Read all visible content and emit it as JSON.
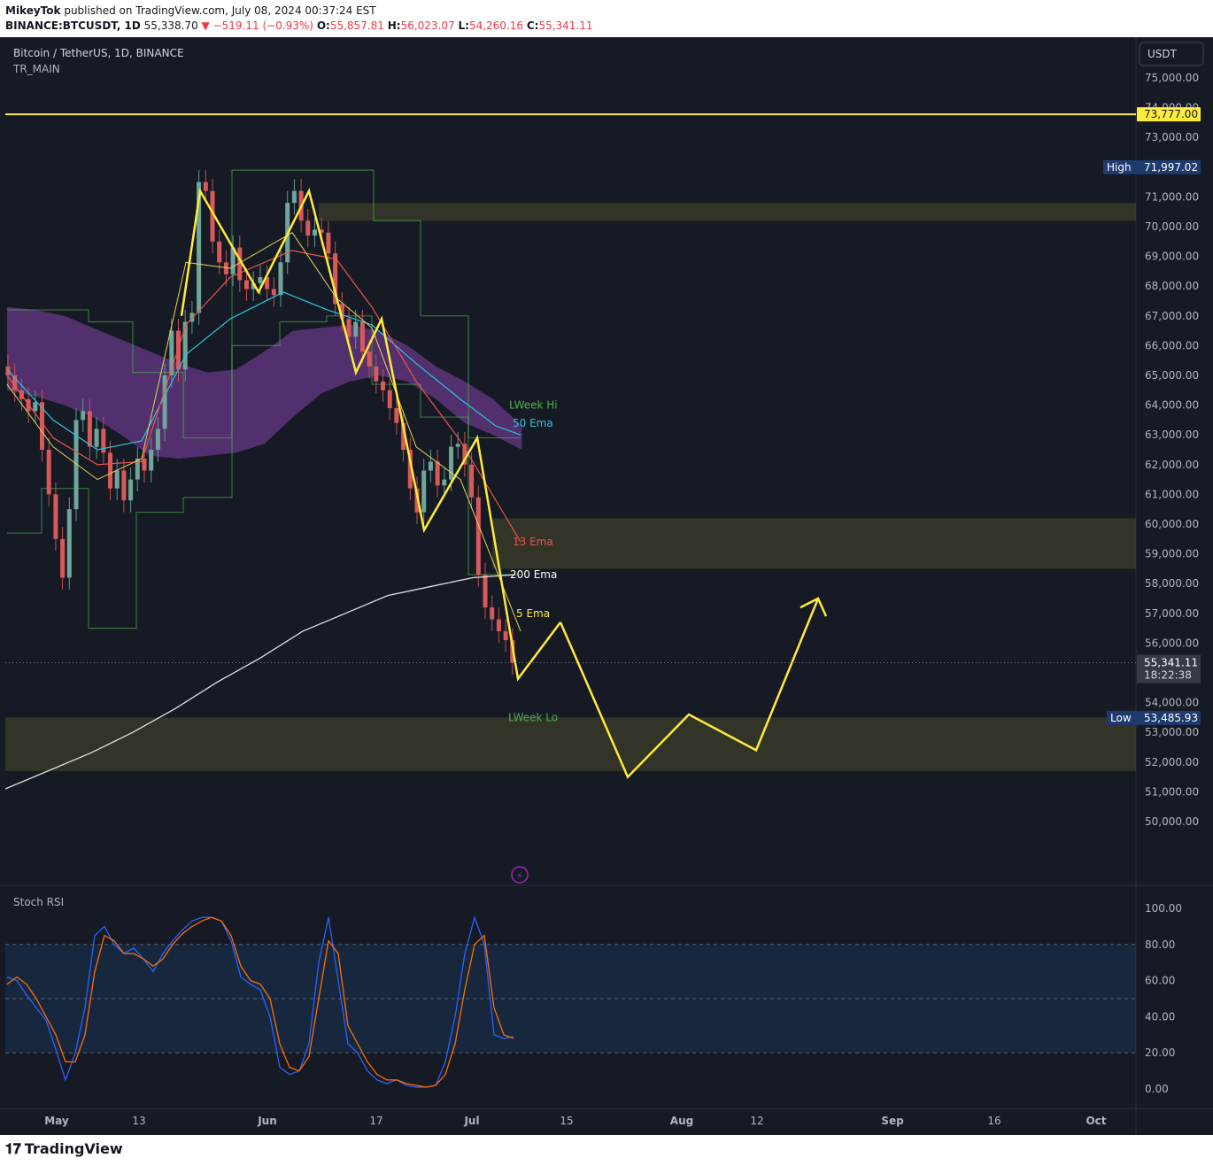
{
  "header": {
    "user": "MikeyTok",
    "published": "published on TradingView.com, July 08, 2024 00:37:24 EST",
    "symbol": "BINANCE:BTCUSDT, 1D",
    "last": "55,338.70",
    "change": "−519.11 (−0.93%)",
    "o": "55,857.81",
    "h": "56,023.07",
    "l": "54,260.16",
    "c": "55,341.11"
  },
  "legend": {
    "title": "Bitcoin / TetherUS, 1D, BINANCE",
    "indicator": "TR_MAIN"
  },
  "currency": "USDT",
  "countdown": "18:22:38",
  "footer": {
    "brand": "TradingView"
  },
  "colors": {
    "bg": "#161a25",
    "up": "#089981",
    "down": "#f23645",
    "yellow": "#ffeb3b",
    "ema50": "#26c6da",
    "ema13": "#ef5350",
    "band": "#7b3fa0"
  },
  "chart_data": [
    {
      "type": "candlestick",
      "ylim": [
        49200,
        75800
      ],
      "y_ticks": [
        "50,000.00",
        "51,000.00",
        "52,000.00",
        "53,000.00",
        "54,000.00",
        "55,000.00",
        "56,000.00",
        "57,000.00",
        "58,000.00",
        "59,000.00",
        "60,000.00",
        "61,000.00",
        "62,000.00",
        "63,000.00",
        "64,000.00",
        "65,000.00",
        "66,000.00",
        "67,000.00",
        "68,000.00",
        "69,000.00",
        "70,000.00",
        "71,000.00",
        "72,000.00",
        "73,000.00",
        "74,000.00",
        "75,000.00"
      ],
      "x_ticks": [
        "May",
        "13",
        "Jun",
        "17",
        "Jul",
        "15",
        "Aug",
        "12",
        "Sep",
        "16",
        "Oct"
      ],
      "price_labels": [
        {
          "text": "73,777.00",
          "price": 73777
        },
        {
          "tag": "High",
          "text": "71,997.02",
          "price": 71997
        },
        {
          "text": "55,341.11",
          "price": 55341
        },
        {
          "tag": "Low",
          "text": "53,485.93",
          "price": 53486
        }
      ],
      "annotations": [
        "LWeek Hi",
        "50 Ema",
        "13 Ema",
        "200 Ema",
        "5 Ema",
        "LWeek Lo"
      ],
      "zones": [
        [
          70200,
          70800
        ],
        [
          58500,
          60200
        ],
        [
          51700,
          53500
        ]
      ],
      "projection_path": [
        [
          56700,
          0
        ],
        [
          51500,
          1
        ],
        [
          53600,
          2
        ],
        [
          52400,
          3
        ],
        [
          57500,
          4
        ],
        [
          56900,
          5
        ]
      ],
      "candles_close_approx": [
        65000,
        64500,
        64200,
        63800,
        64100,
        62500,
        61000,
        59500,
        58200,
        60500,
        63500,
        63800,
        62600,
        63200,
        62400,
        61200,
        61800,
        60800,
        61500,
        62200,
        61800,
        62500,
        63200,
        65000,
        66500,
        65200,
        66800,
        67100,
        71500,
        71200,
        69500,
        68800,
        68400,
        69300,
        68200,
        67900,
        68100,
        68300,
        67900,
        67700,
        68800,
        70800,
        71200,
        70200,
        69700,
        69900,
        69800,
        69100,
        67400,
        66900,
        66300,
        66800,
        65800,
        65300,
        64800,
        64500,
        63900,
        63400,
        62500,
        61200,
        60400,
        61800,
        62100,
        61300,
        61500,
        62600,
        62700,
        62000,
        60900,
        58300,
        57200,
        56800,
        56400,
        56100,
        55341
      ],
      "ema200_approx": [
        51100,
        51700,
        52300,
        53000,
        53800,
        54700,
        55500,
        56400,
        57000,
        57600,
        57900,
        58200,
        58300
      ]
    },
    {
      "type": "line",
      "title": "Stoch RSI",
      "ylim": [
        0,
        100
      ],
      "y_ticks": [
        "0.00",
        "20.00",
        "40.00",
        "60.00",
        "80.00",
        "100.00"
      ],
      "band": [
        20,
        80
      ],
      "series": [
        {
          "values": [
            62,
            60,
            52,
            45,
            38,
            22,
            5,
            20,
            45,
            85,
            90,
            80,
            75,
            78,
            72,
            65,
            75,
            82,
            88,
            93,
            95,
            95,
            93,
            82,
            62,
            58,
            55,
            40,
            12,
            8,
            10,
            25,
            70,
            95,
            60,
            25,
            20,
            10,
            5,
            3,
            5,
            2,
            1,
            1,
            2,
            15,
            40,
            75,
            95,
            80,
            30,
            28,
            29
          ]
        },
        {
          "values": [
            58,
            62,
            58,
            50,
            40,
            30,
            15,
            15,
            30,
            65,
            85,
            82,
            75,
            75,
            72,
            68,
            72,
            80,
            86,
            90,
            93,
            95,
            93,
            85,
            68,
            60,
            58,
            50,
            25,
            12,
            10,
            18,
            50,
            82,
            75,
            35,
            25,
            15,
            8,
            5,
            5,
            3,
            2,
            1,
            2,
            8,
            25,
            55,
            80,
            85,
            45,
            30,
            28
          ]
        }
      ]
    }
  ]
}
